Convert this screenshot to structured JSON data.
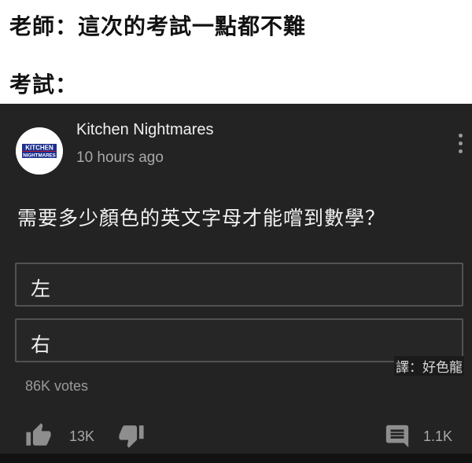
{
  "captions": {
    "teacher": "老師：這次的考試一點都不難",
    "exam": "考試："
  },
  "post": {
    "channel_name": "Kitchen Nightmares",
    "time_ago": "10 hours ago",
    "avatar_logo_lines": [
      "KITCHEN",
      "NIGHTMARES"
    ],
    "menu_icon": "more-vertical-icon",
    "question": "需要多少顏色的英文字母才能嚐到數學？",
    "options": [
      {
        "label": "左"
      },
      {
        "label": "右"
      }
    ],
    "translator_credit": "譯：好色龍",
    "votes": "86K votes",
    "likes": "13K",
    "comments": "1.1K",
    "icons": {
      "like": "thumbs-up-icon",
      "dislike": "thumbs-down-icon",
      "comment": "comment-icon"
    }
  },
  "colors": {
    "card_background": "#232323",
    "page_background": "#ffffff",
    "option_border": "#525252"
  }
}
